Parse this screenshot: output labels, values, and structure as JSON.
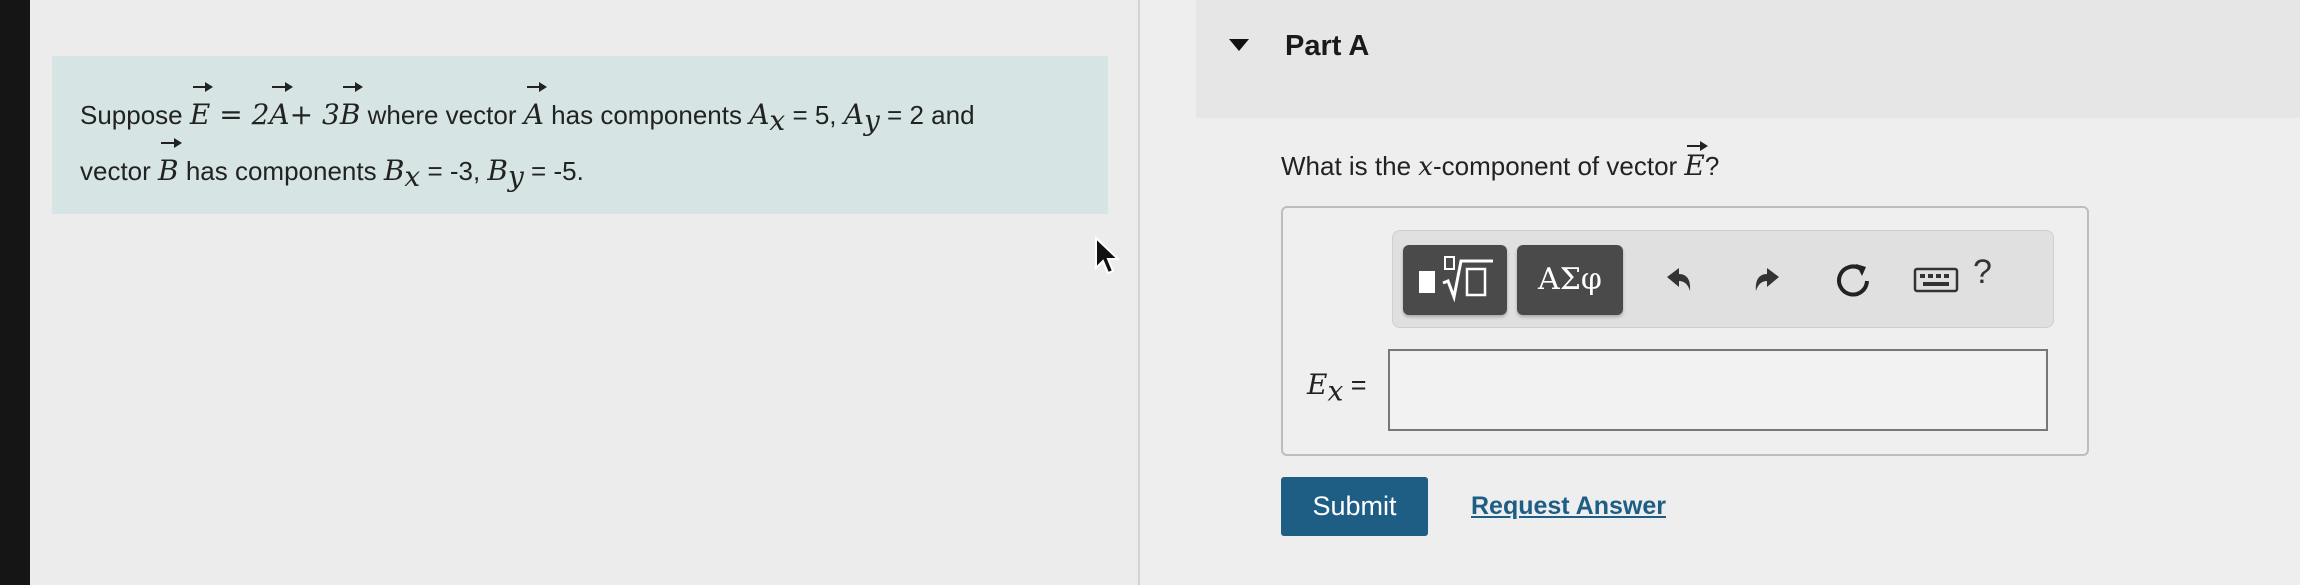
{
  "problem": {
    "t_suppose": "Suppose",
    "E": "E",
    "eq_mid": " = 2",
    "A": "A",
    "plus": "+ 3",
    "B": "B",
    "t_where": " where vector ",
    "t_has": " has components ",
    "Ax": "A",
    "Ax_sub": "x",
    "Ax_val": " = 5, ",
    "Ay": "A",
    "Ay_sub": "y",
    "Ay_val": " = 2 and",
    "t_vector": "vector ",
    "t_has2": " has components ",
    "Bx": "B",
    "Bx_sub": "x",
    "Bx_val": " = -3, ",
    "By": "B",
    "By_sub": "y",
    "By_val": " = -5."
  },
  "part": {
    "title": "Part A"
  },
  "question": {
    "prefix": "What is the ",
    "x": "x",
    "middle": "-component of vector ",
    "E": "E",
    "suffix": "?"
  },
  "toolbar": {
    "symbols_label": "ΑΣφ",
    "help_label": "?",
    "icons": [
      "templates-icon",
      "undo-icon",
      "redo-icon",
      "reset-icon",
      "keyboard-icon",
      "help-icon"
    ]
  },
  "answer": {
    "label_var": "E",
    "label_sub": "x",
    "label_eq": " =",
    "value": ""
  },
  "actions": {
    "submit_label": "Submit",
    "request_label": "Request Answer"
  },
  "colors": {
    "problem_bg": "#d6e4e4",
    "accent": "#1e5d84",
    "toolbar_button": "#4a4a4a"
  }
}
